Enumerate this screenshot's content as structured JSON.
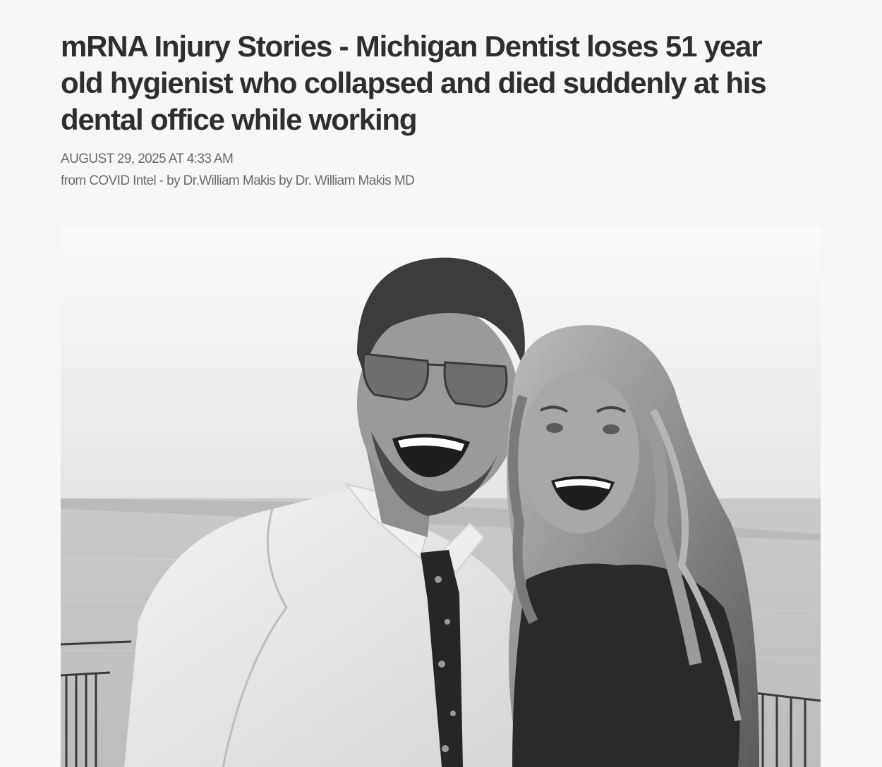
{
  "article": {
    "title": "mRNA Injury Stories - Michigan Dentist loses 51 year old hygienist who collapsed and died suddenly at his dental office while working",
    "date": "AUGUST 29, 2025 AT 4:33 AM",
    "byline": "from COVID Intel - by Dr.William Makis by Dr. William Makis MD"
  },
  "image": {
    "subject": "black-and-white-photo-couple-by-water",
    "style": "grayscale"
  }
}
